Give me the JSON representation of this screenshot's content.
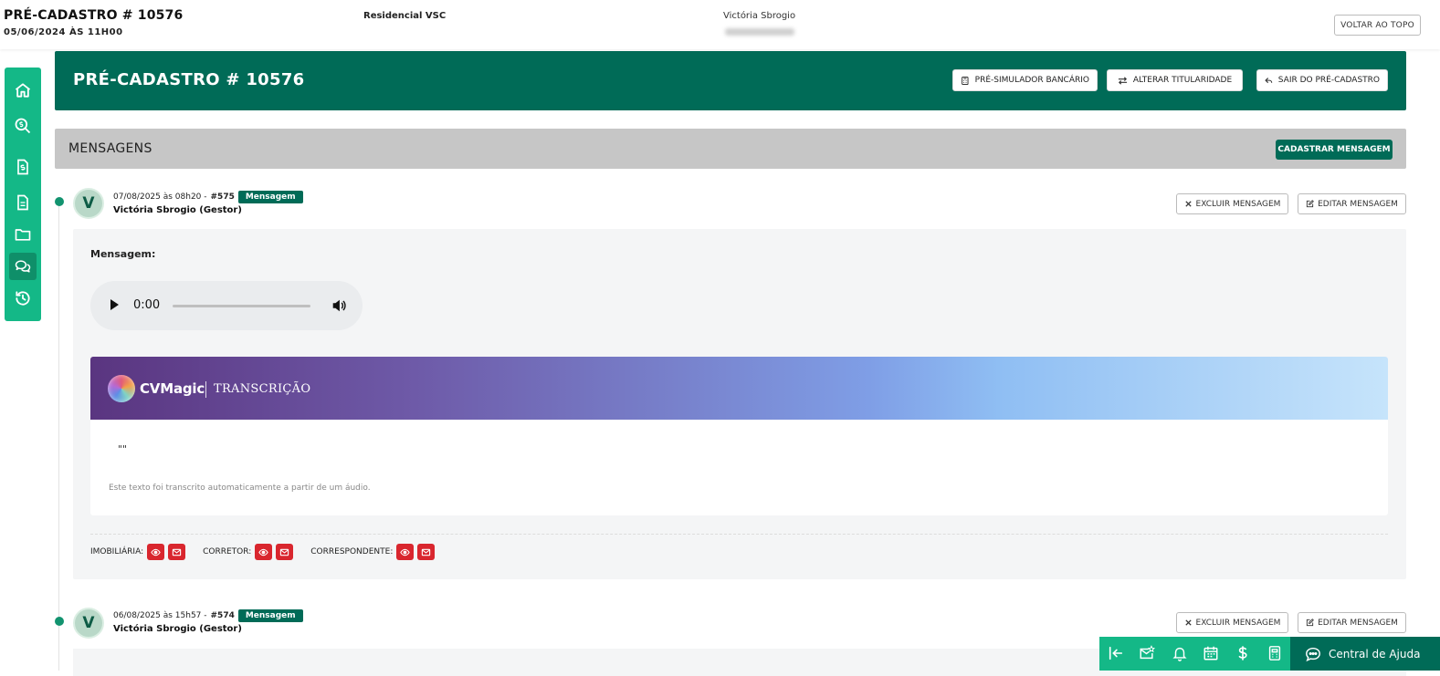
{
  "header": {
    "title": "PRÉ-CADASTRO # 10576",
    "date": "05/06/2024 ÀS 11H00",
    "empreendimento": "Residencial VSC",
    "cliente": "Victória Sbrogio",
    "back_to_top": "VOLTAR AO TOPO"
  },
  "sidebar": {
    "items": [
      {
        "icon": "home-icon"
      },
      {
        "icon": "search-dollar-icon"
      },
      {
        "icon": "invoice-icon"
      },
      {
        "icon": "document-icon"
      },
      {
        "icon": "folder-icon"
      },
      {
        "icon": "chat-icon",
        "active": true
      },
      {
        "icon": "history-icon"
      }
    ]
  },
  "banner": {
    "title": "PRÉ-CADASTRO # 10576",
    "buttons": {
      "simulador": "PRÉ-SIMULADOR BANCÁRIO",
      "titularidade": "ALTERAR TITULARIDADE",
      "sair": "SAIR DO PRÉ-CADASTRO"
    }
  },
  "messages_section": {
    "title": "MENSAGENS",
    "add_button": "CADASTRAR MENSAGEM"
  },
  "messages": [
    {
      "avatar": "V",
      "datetime": "07/08/2025 às 08h20 -",
      "id": "#575",
      "badge": "Mensagem",
      "author": "Victória Sbrogio (Gestor)",
      "delete_label": "EXCLUIR MENSAGEM",
      "edit_label": "EDITAR MENSAGEM",
      "body_label": "Mensagem:",
      "audio_time": "0:00",
      "cvmagic": {
        "brand": "CVMagic",
        "section": "TRANSCRIÇÃO",
        "text": "\"\"",
        "note": "Este texto foi transcrito automaticamente a partir de um áudio."
      },
      "flags": {
        "imobiliaria": "IMOBILIÁRIA:",
        "corretor": "CORRETOR:",
        "correspondente": "CORRESPONDENTE:"
      }
    },
    {
      "avatar": "V",
      "datetime": "06/08/2025 às 15h57 -",
      "id": "#574",
      "badge": "Mensagem",
      "author": "Victória Sbrogio (Gestor)",
      "delete_label": "EXCLUIR MENSAGEM",
      "edit_label": "EDITAR MENSAGEM"
    }
  ],
  "bottom_bar": {
    "icons": [
      "collapse-left-icon",
      "mail-star-icon",
      "bell-icon",
      "calendar-icon",
      "dollar-icon",
      "calculator-icon"
    ],
    "help_label": "Central de Ajuda"
  },
  "colors": {
    "primary_dark": "#006b57",
    "primary_light": "#14b887",
    "danger": "#d9262e",
    "section_gray": "#c6c6c6"
  }
}
